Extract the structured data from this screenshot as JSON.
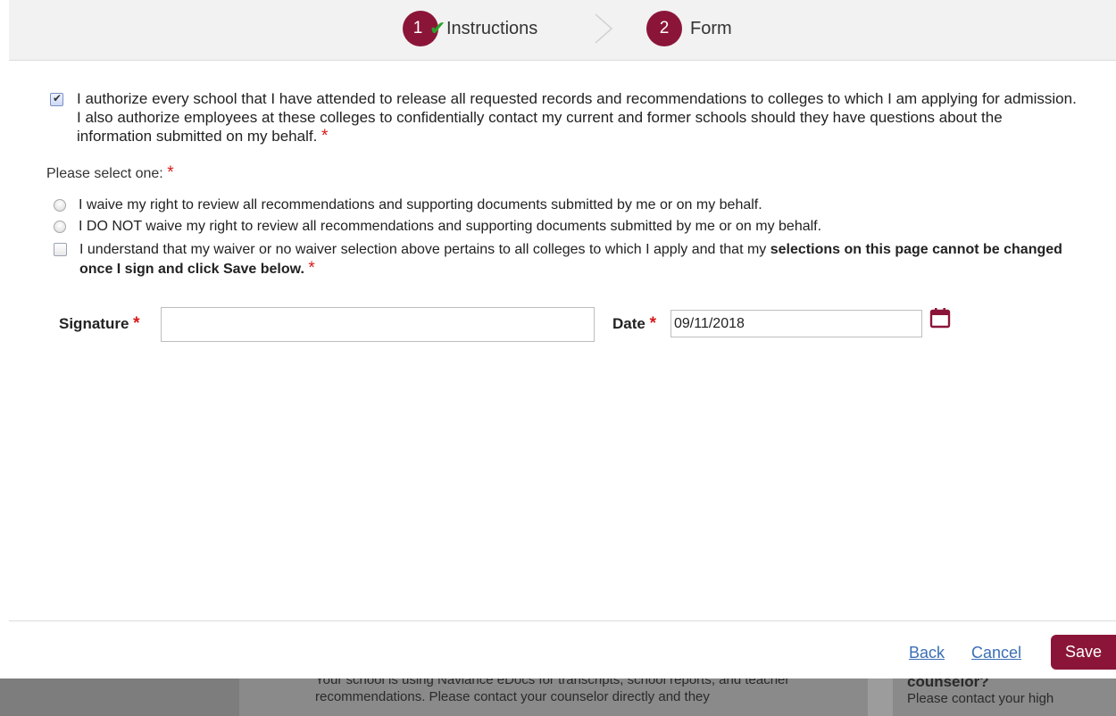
{
  "steps": [
    {
      "number": "1",
      "label": "Instructions",
      "completed": true
    },
    {
      "number": "2",
      "label": "Form"
    }
  ],
  "authorization": {
    "checked": true,
    "text": "I authorize every school that I have attended to release all requested records and recommendations to colleges to which I am applying for admission. I also authorize employees at these colleges to confidentially contact my current and former schools should they have questions about the information submitted on my behalf.",
    "required_marker": "*"
  },
  "selection": {
    "prompt": "Please select one:",
    "required_marker": "*",
    "options": [
      {
        "label": "I waive my right to review all recommendations and supporting documents submitted by me or on my behalf.",
        "selected": false
      },
      {
        "label": "I DO NOT waive my right to review all recommendations and supporting documents submitted by me or on my behalf.",
        "selected": false
      }
    ]
  },
  "understanding": {
    "checked": false,
    "text_plain": "I understand that my waiver or no waiver selection above pertains to all colleges to which I apply and that my",
    "text_bold": "selections on this page cannot be changed once I sign and click Save below.",
    "required_marker": "*"
  },
  "signature": {
    "label": "Signature",
    "required_marker": "*",
    "value": ""
  },
  "date": {
    "label": "Date",
    "required_marker": "*",
    "value": "09/11/2018"
  },
  "actions": {
    "back": "Back",
    "cancel": "Cancel",
    "save": "Save"
  },
  "background_page": {
    "center_text": "Your school is using Naviance eDocs for transcripts, school reports, and teacher recommendations. Please contact your counselor directly and they",
    "right_title": "counselor?",
    "right_text": "Please contact your high"
  },
  "colors": {
    "brand": "#8b1538",
    "link": "#3a6fb5",
    "required": "#d71a1a",
    "check": "#2ca02c"
  }
}
